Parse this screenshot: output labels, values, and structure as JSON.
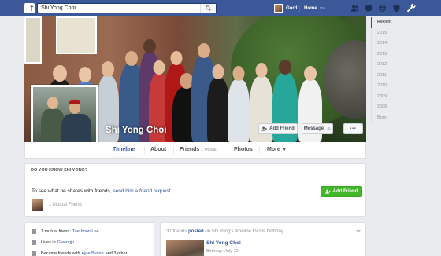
{
  "topbar": {
    "logo": "f",
    "search_value": "Shi Yong Choi",
    "user_name": "Gord",
    "home_label": "Home",
    "home_count": "20+"
  },
  "profile": {
    "name": "Shi Yong Choi",
    "add_friend_label": "Add Friend",
    "message_label": "Message",
    "more_dots": "•••"
  },
  "tabs": {
    "timeline": "Timeline",
    "about": "About",
    "friends": "Friends",
    "friends_sub": "1 Mutual",
    "photos": "Photos",
    "more": "More"
  },
  "pymk": {
    "title": "DO YOU KNOW SHI YONG?",
    "text_prefix": "To see what he shares with friends, ",
    "text_link": "send him a friend request",
    "text_suffix": ".",
    "button_label": "Add Friend",
    "mutual_label": "1 Mutual Friend"
  },
  "about": {
    "mutual_prefix": "1 mutual friend:",
    "mutual_name": "Tae-hoon Lee",
    "lives_prefix": "Lives in",
    "lives_place": "Gwangju",
    "became_prefix": "Became friends with",
    "became_name": "Ajoe Byone",
    "became_suffix": "and 3 other"
  },
  "post": {
    "count_text": "31 friends",
    "posted_text": "posted",
    "on_text": "on Shi Yong's timeline for his birthday.",
    "name": "Shi Yong Choi",
    "birthday": "Birthday: July 12"
  },
  "years": [
    "Recent",
    "2015",
    "2014",
    "2013",
    "2012",
    "2011",
    "2010",
    "2009",
    "2008",
    "Born"
  ],
  "colors": {
    "brand": "#3b5998",
    "link": "#365899",
    "green": "#42b72a"
  },
  "icons": [
    "search-icon",
    "friend-requests-icon",
    "messages-icon",
    "notifications-icon",
    "privacy-icon",
    "settings-icon",
    "add-friend-icon",
    "more-dots-icon",
    "chevron-down-icon"
  ]
}
